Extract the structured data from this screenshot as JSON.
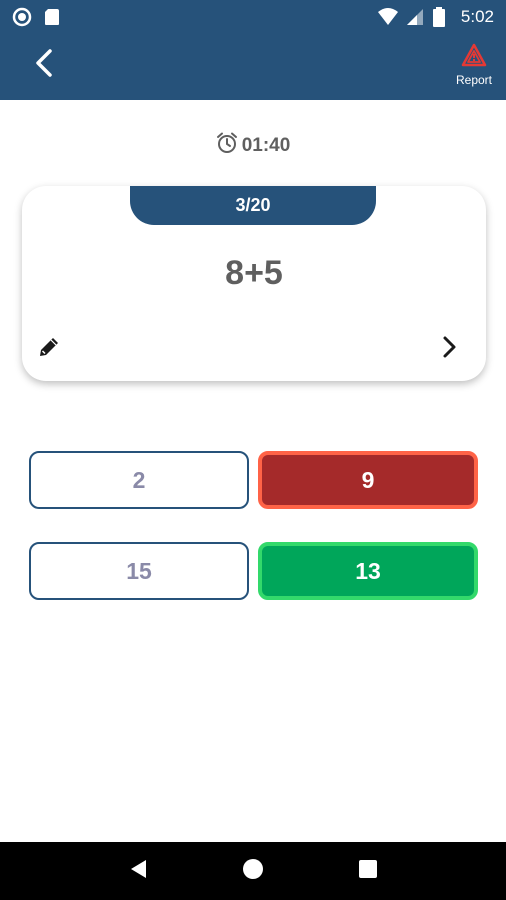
{
  "status_bar": {
    "time": "5:02",
    "icons": [
      "circle-notification-icon",
      "sd-card-icon",
      "wifi-icon",
      "cell-signal-icon",
      "battery-icon"
    ]
  },
  "app_bar": {
    "back_icon": "chevron-left-icon",
    "report_icon": "warning-triangle-icon",
    "report_label": "Report"
  },
  "timer": {
    "icon": "alarm-clock-icon",
    "value": "01:40"
  },
  "card": {
    "progress": "3/20",
    "question": "8+5",
    "edit_icon": "pencil-icon",
    "next_icon": "chevron-right-icon"
  },
  "options": [
    {
      "label": "2",
      "state": "neutral"
    },
    {
      "label": "9",
      "state": "wrong"
    },
    {
      "label": "15",
      "state": "neutral"
    },
    {
      "label": "13",
      "state": "correct"
    }
  ],
  "nav_bar": {
    "icons": [
      "back-triangle-icon",
      "home-circle-icon",
      "recents-square-icon"
    ]
  },
  "colors": {
    "primary": "#26527a",
    "wrong": "#a52a2a",
    "wrong_border": "#ff6347",
    "correct": "#00a65a",
    "correct_border": "#33d96b",
    "report_icon": "#e53935"
  }
}
